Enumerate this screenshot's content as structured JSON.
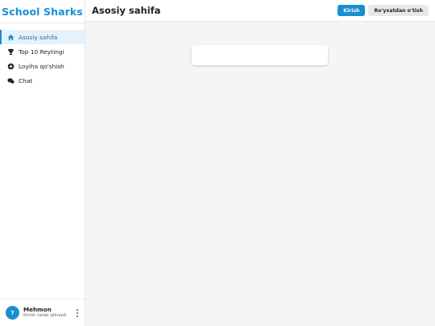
{
  "brand": {
    "name": "School Sharks",
    "color": "#1a8fd0"
  },
  "sidebar": {
    "items": [
      {
        "label": "Asosiy sahifa",
        "icon": "home-icon",
        "active": true
      },
      {
        "label": "Top 10 Reytingi",
        "icon": "trophy-icon",
        "active": false
      },
      {
        "label": "Loyiha qo'shish",
        "icon": "plus-circle-icon",
        "active": false
      },
      {
        "label": "Chat",
        "icon": "chat-bubbles-icon",
        "active": false
      }
    ]
  },
  "user": {
    "avatar_initial": "?",
    "name": "Mehmon",
    "status": "Kirish talab qilinadi"
  },
  "header": {
    "title": "Asosiy sahifa",
    "login_label": "Kirish",
    "register_label": "Ro'yxatdan o'tish"
  },
  "colors": {
    "accent": "#1a8fd0",
    "active_bg": "#e6f2fb",
    "background": "#f5f5f5"
  }
}
